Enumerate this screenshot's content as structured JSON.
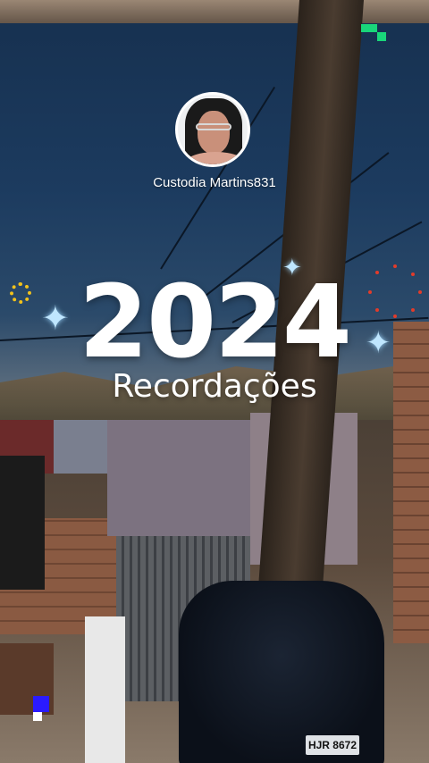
{
  "story": {
    "username": "Custodia Martins831",
    "year": "2024",
    "subtitle": "Recordações"
  },
  "background": {
    "license_plate": "HJR 8672"
  },
  "colors": {
    "sparkle": "#bfe6ff",
    "sun": "#f2c21b",
    "dots": "#e23b2a",
    "pixel_green": "#19d67a",
    "pixel_blue": "#2a1bff"
  },
  "icons": {
    "sparkle": "four-point-star",
    "sun": "dotted-sun"
  }
}
